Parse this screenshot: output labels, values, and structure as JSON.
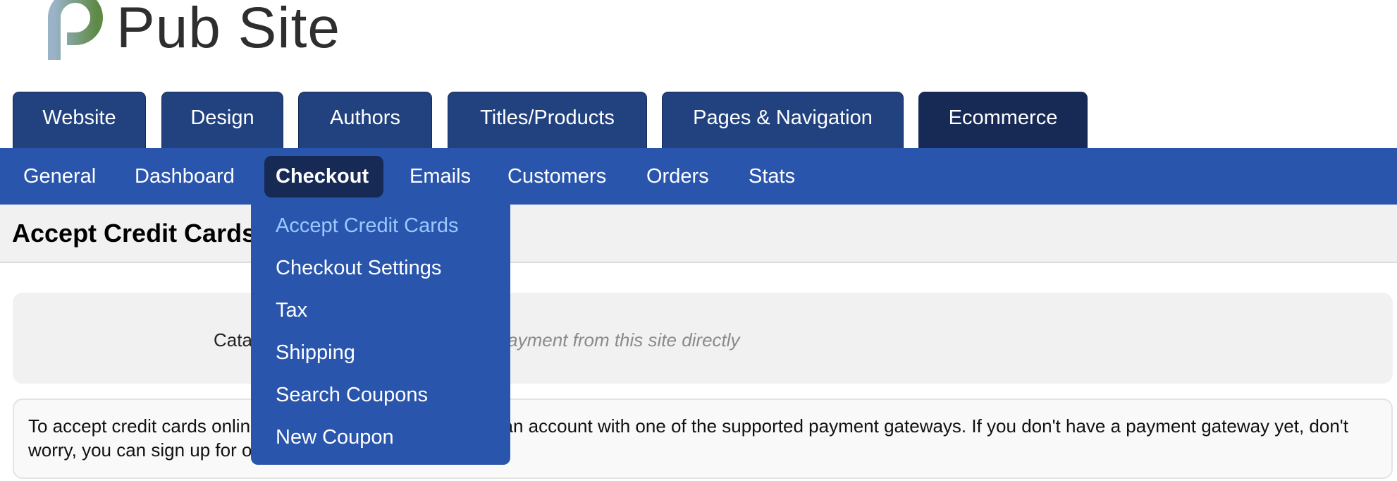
{
  "logo": {
    "text": "Pub Site"
  },
  "main_tabs": [
    {
      "label": "Website"
    },
    {
      "label": "Design"
    },
    {
      "label": "Authors"
    },
    {
      "label": "Titles/Products"
    },
    {
      "label": "Pages & Navigation"
    },
    {
      "label": "Ecommerce",
      "active": true
    }
  ],
  "sub_nav": [
    {
      "label": "General"
    },
    {
      "label": "Dashboard"
    },
    {
      "label": "Checkout",
      "active": true
    },
    {
      "label": "Emails"
    },
    {
      "label": "Customers"
    },
    {
      "label": "Orders"
    },
    {
      "label": "Stats"
    }
  ],
  "dropdown": [
    {
      "label": "Accept Credit Cards",
      "hover": true
    },
    {
      "label": "Checkout Settings"
    },
    {
      "label": "Tax"
    },
    {
      "label": "Shipping"
    },
    {
      "label": "Search Coupons"
    },
    {
      "label": "New Coupon"
    }
  ],
  "page": {
    "title": "Accept Credit Cards",
    "catalog_label": "Catalog Mode:",
    "catalog_value": "Do not accept payment from this site directly",
    "info": "To accept credit cards online, you need to have registered an account with one of the supported payment gateways. If you don't have a payment gateway yet, don't worry, you can sign up for one here."
  },
  "colors": {
    "tab": "#22427f",
    "tab_active": "#172a55",
    "subnav": "#2a55ac",
    "dropdown_hover": "#9cc8ff"
  }
}
